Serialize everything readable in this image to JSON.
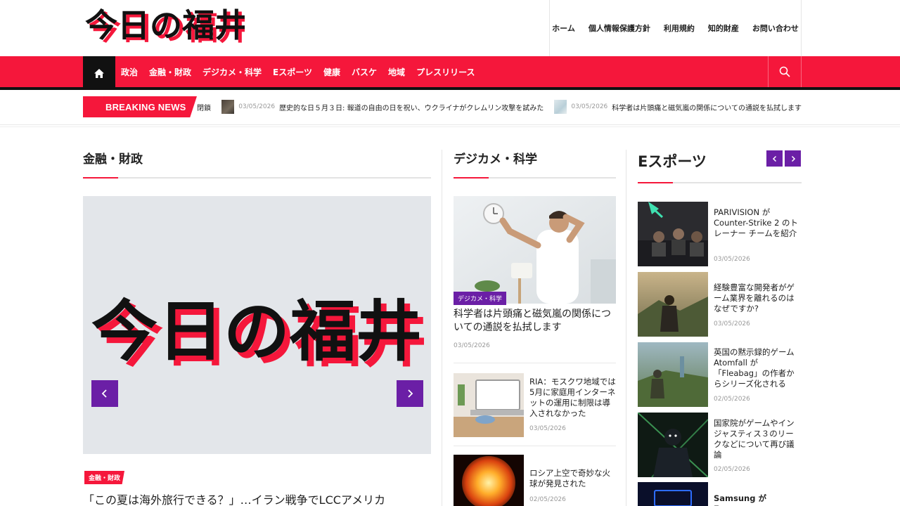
{
  "header": {
    "logo_text": "今日の福井",
    "top_nav": [
      "ホーム",
      "個人情報保護方針",
      "利用規約",
      "知的財産",
      "お問い合わせ"
    ]
  },
  "nav": {
    "items": [
      "政治",
      "金融・財政",
      "デジカメ・科学",
      "Eスポーツ",
      "健康",
      "バスケ",
      "地域",
      "プレスリリース"
    ],
    "home_icon": "home-icon",
    "search_icon": "search-icon"
  },
  "breaking": {
    "label": "BREAKING NEWS",
    "items": [
      {
        "prefix": "閉鎖"
      },
      {
        "date": "03/05/2026",
        "text": "歴史的な日５月３日: 報道の自由の日を祝い、ウクライナがクレムリン攻撃を試みた"
      },
      {
        "date": "03/05/2026",
        "text": "科学者は片頭痛と磁気嵐の関係についての通説を払拭します"
      }
    ]
  },
  "finance": {
    "title": "金融・財政",
    "slide_logo": "今日の福井",
    "badge": "金融・財政",
    "lead_title": "「この夏は海外旅行できる？」…イラン戦争でLCCアメリカ"
  },
  "digicame": {
    "title": "デジカメ・科学",
    "main": {
      "category": "デジカメ・科学",
      "title": "科学者は片頭痛と磁気嵐の関係についての通説を払拭します",
      "date": "03/05/2026"
    },
    "list": [
      {
        "title": "RIA：モスクワ地域では5月に家庭用インターネットの運用に制限は導入されなかった",
        "date": "03/05/2026"
      },
      {
        "title": "ロシア上空で奇妙な火球が発見された",
        "date": "02/05/2026"
      }
    ]
  },
  "esports": {
    "title": "Eスポーツ",
    "list": [
      {
        "title": "PARIVISION が Counter-Strike 2 のトレーナー チームを紹介",
        "date": "03/05/2026"
      },
      {
        "title": "経験豊富な開発者がゲーム業界を離れるのはなぜですか?",
        "date": "03/05/2026"
      },
      {
        "title": "英国の黙示録的ゲーム Atomfall が「Fleabag」の作者からシリーズ化される",
        "date": "02/05/2026"
      },
      {
        "title": "国家院がゲームやインジャスティス３のリークなどについて再び議論",
        "date": "02/05/2026"
      },
      {
        "title": "Samsung が Exynos",
        "date": ""
      }
    ]
  },
  "colors": {
    "brand_red": "#f5173b",
    "purple": "#6b1fa6",
    "nav_dark": "#111111"
  }
}
